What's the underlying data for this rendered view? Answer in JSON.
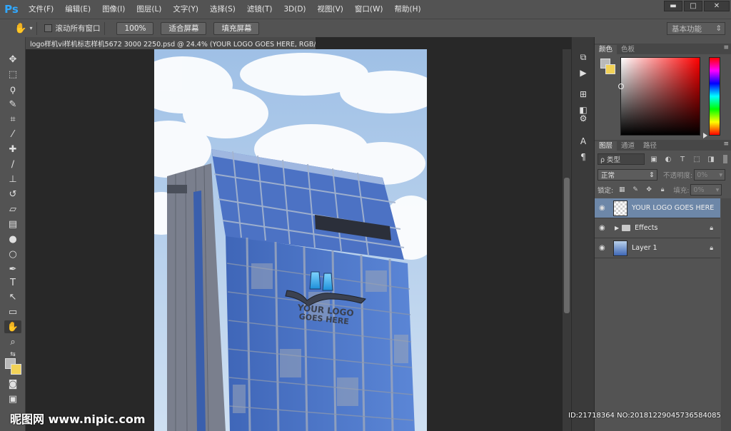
{
  "app": {
    "logo": "Ps",
    "menus": [
      "文件(F)",
      "编辑(E)",
      "图像(I)",
      "图层(L)",
      "文字(Y)",
      "选择(S)",
      "滤镜(T)",
      "3D(D)",
      "视图(V)",
      "窗口(W)",
      "帮助(H)"
    ],
    "window_controls": {
      "minimize": "▬",
      "restore": "□",
      "close": "✕"
    }
  },
  "options_bar": {
    "tool_icon": "hand-icon",
    "scroll_all_label": "滚动所有窗口",
    "btn_100": "100%",
    "btn_fit": "适合屏幕",
    "btn_fill": "填充屏幕",
    "workspace": "基本功能"
  },
  "document": {
    "tab_title": "logo样机vi样机标志样机5672 3000 2250.psd @ 24.4% (YOUR LOGO GOES HERE, RGB/8) *",
    "tab_close": "×",
    "logo_text_line1": "YOUR LOGO",
    "logo_text_line2": "GOES HERE"
  },
  "panels": {
    "color_tabs": [
      "颜色",
      "色板"
    ],
    "layers_tabs": [
      "图层",
      "通道",
      "路径"
    ],
    "filter_kind": "ρ 类型",
    "blend_mode": "正常",
    "opacity_label": "不透明度:",
    "opacity_value": "0%",
    "lock_label": "锁定:",
    "fill_label": "填充:",
    "fill_value": "0%",
    "colors": {
      "foreground": "#b9b9b9",
      "background": "#f2d257",
      "selected_layer": "#6d87a8"
    }
  },
  "layers": [
    {
      "name": "YOUR LOGO GOES HERE",
      "type": "smart-object",
      "selected": true,
      "locked": false
    },
    {
      "name": "Effects",
      "type": "group",
      "selected": false,
      "locked": true
    },
    {
      "name": "Layer 1",
      "type": "image",
      "selected": false,
      "locked": true
    }
  ],
  "watermark": {
    "left": "昵图网 www.nipic.com",
    "right": "ID:21718364 NO:20181229045736584085"
  }
}
